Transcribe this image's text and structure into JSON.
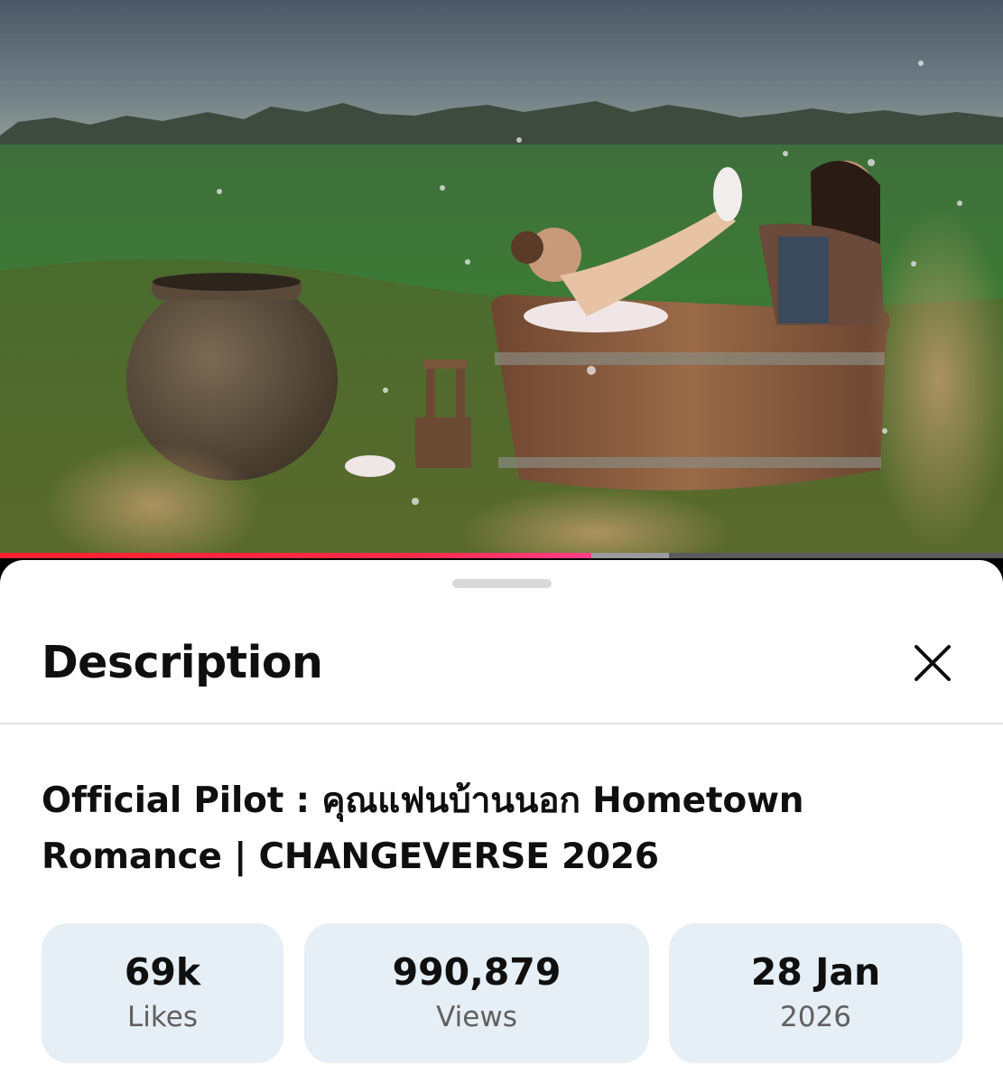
{
  "player": {
    "progress_played_fraction": 0.59,
    "progress_buffered_fraction": 0.667,
    "accent_color": "#ff1f2f"
  },
  "sheet": {
    "title": "Description",
    "close_icon": "close-icon"
  },
  "video": {
    "title": "Official Pilot : คุณแฟนบ้านนอก Hometown Romance | CHANGEVERSE 2026"
  },
  "stats": [
    {
      "value": "69k",
      "label": "Likes"
    },
    {
      "value": "990,879",
      "label": "Views"
    },
    {
      "value": "28 Jan",
      "label": "2026"
    }
  ]
}
